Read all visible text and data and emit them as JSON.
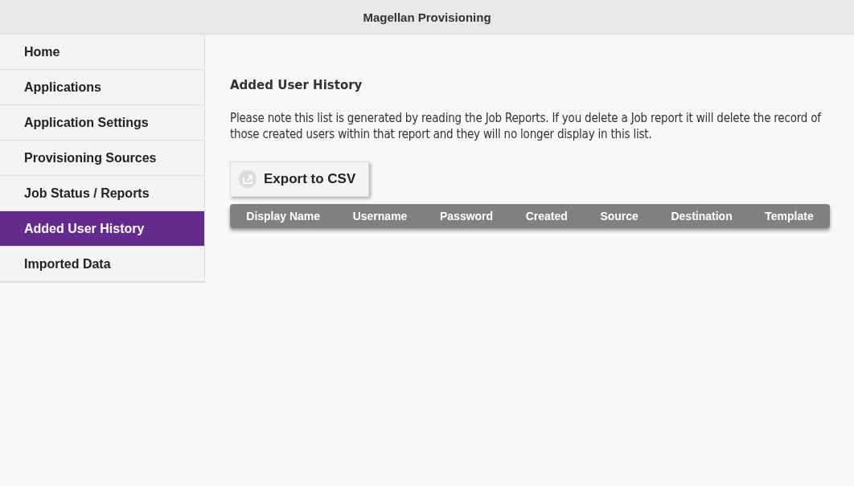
{
  "window": {
    "title": "Magellan Provisioning"
  },
  "sidebar": {
    "items": [
      {
        "label": "Home",
        "selected": false
      },
      {
        "label": "Applications",
        "selected": false
      },
      {
        "label": "Application Settings",
        "selected": false
      },
      {
        "label": "Provisioning Sources",
        "selected": false
      },
      {
        "label": "Job Status / Reports",
        "selected": false
      },
      {
        "label": "Added User History",
        "selected": true
      },
      {
        "label": "Imported Data",
        "selected": false
      }
    ]
  },
  "content": {
    "heading": "Added User History",
    "note": "Please note this list is generated by reading the Job Reports. If you delete a Job report it will delete the record of those created users within that report and they will no longer display in this list.",
    "export_button": "Export to CSV",
    "table": {
      "columns": [
        "Display Name",
        "Username",
        "Password",
        "Created",
        "Source",
        "Destination",
        "Template"
      ]
    }
  }
}
